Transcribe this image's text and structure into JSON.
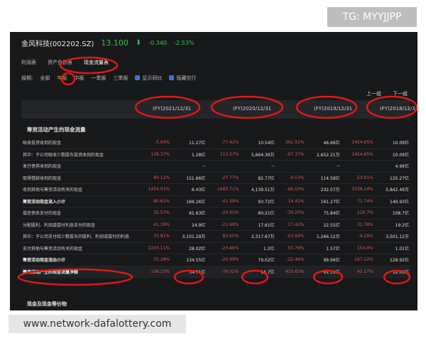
{
  "watermark_top": "TG: MYYJJPP",
  "watermark_bottom": "www.network-dafalottery.com",
  "header": {
    "company": "金风科技(002202.SZ)",
    "price": "13.100",
    "change": "-0.340",
    "change_pct": "-2.53%"
  },
  "tabs": [
    "利润表",
    "资产负债表",
    "现金流量表"
  ],
  "filters": {
    "label": "报期:",
    "options": [
      "全部",
      "年报",
      "中报",
      "一季报",
      "三季报"
    ],
    "show_yoy": "显示同比",
    "hide_empty": "隐藏空行"
  },
  "nav": {
    "prev": "上一组",
    "next": "下一组"
  },
  "periods": [
    "(FY)2021/12/31",
    "(FY)2020/12/31",
    "(FY)2019/12/31",
    "(FY)2018/12/31"
  ],
  "section_title": "筹资活动产生的现金流量",
  "rows": [
    {
      "name": "吸收投资收到的现金",
      "cells": [
        [
          "-5.94%",
          "11.27亿"
        ],
        [
          "-77.42%",
          "10.54亿"
        ],
        [
          "362.51%",
          "46.66亿"
        ],
        [
          "1454.65%",
          "10.09亿"
        ]
      ]
    },
    {
      "name": "其中：子公司吸收少数股东投资收到的现金",
      "cells": [
        [
          "128.37%",
          "1.28亿"
        ],
        [
          "113.57%",
          "5,664.36万"
        ],
        [
          "-97.37%",
          "2,652.21万"
        ],
        [
          "1454.65%",
          "10.09亿"
        ]
      ]
    },
    {
      "name": "发行债券收到的现金",
      "cells": [
        [
          "",
          "--"
        ],
        [
          "",
          "--"
        ],
        [
          "",
          "--"
        ],
        [
          "",
          "4.99亿"
        ]
      ]
    },
    {
      "name": "取得借款收到的现金",
      "cells": [
        [
          "83.12%",
          "151.66亿"
        ],
        [
          "-27.77%",
          "82.77亿"
        ],
        [
          "-9.53%",
          "114.58亿"
        ],
        [
          "53.91%",
          "125.27亿"
        ]
      ]
    },
    {
      "name": "收到其他与筹资活动有关的现金",
      "cells": [
        [
          "1454.01%",
          "6.43亿"
        ],
        [
          "1683.71%",
          "4,139.51万"
        ],
        [
          "-96.03%",
          "232.07万"
        ],
        [
          "2538.24%",
          "5,842.49万"
        ]
      ]
    },
    {
      "name": "筹资活动现金流入小计",
      "bold": true,
      "cells": [
        [
          "80.61%",
          "169.26亿"
        ],
        [
          "-41.59%",
          "93.72亿"
        ],
        [
          "14.42%",
          "161.27亿"
        ],
        [
          "71.74%",
          "140.93亿"
        ]
      ]
    },
    {
      "name": "偿还债务支付的现金",
      "cells": [
        [
          "35.57%",
          "81.63亿"
        ],
        [
          "-20.61%",
          "60.21亿"
        ],
        [
          "-30.25%",
          "75.84亿"
        ],
        [
          "226.7%",
          "108.7亿"
        ]
      ]
    },
    {
      "name": "分配股利、利润或偿付利息支付的现金",
      "cells": [
        [
          "41.39%",
          "24.9亿"
        ],
        [
          "-21.69%",
          "17.61亿"
        ],
        [
          "17.42%",
          "22.55亿"
        ],
        [
          "31.78%",
          "19.2亿"
        ]
      ]
    },
    {
      "name": "其中：子公司支付给少数股东的股利、利润或偿付的利息",
      "cells": [
        [
          "33.81%",
          "3,101.29万"
        ],
        [
          "83.05%",
          "2,317.67万"
        ],
        [
          "-63.84%",
          "1,266.12万"
        ],
        [
          "-4.19%",
          "3,501.12万"
        ]
      ]
    },
    {
      "name": "支付其他与筹资活动有关的现金",
      "cells": [
        [
          "2243.11%",
          "28.02亿"
        ],
        [
          "-23.46%",
          "1.2亿"
        ],
        [
          "55.76%",
          "1.57亿"
        ],
        [
          "153.4%",
          "1.01亿"
        ]
      ]
    },
    {
      "name": "筹资活动现金流出小计",
      "bold": true,
      "cells": [
        [
          "72.28%",
          "134.55亿"
        ],
        [
          "-20.99%",
          "79.02亿"
        ],
        [
          "-22.46%",
          "99.96亿"
        ],
        [
          "167.22%",
          "128.92亿"
        ]
      ]
    },
    {
      "name": "筹资活动产生的现金流量净额",
      "bold": true,
      "final": true,
      "cells": [
        [
          "136.15%",
          "34.71亿"
        ],
        [
          "-76.02%",
          "14.7亿"
        ],
        [
          "410.63%",
          "61.31亿"
        ],
        [
          "42.17%",
          "12.01亿"
        ]
      ]
    }
  ],
  "bottom_section": "现金及现金等价物"
}
